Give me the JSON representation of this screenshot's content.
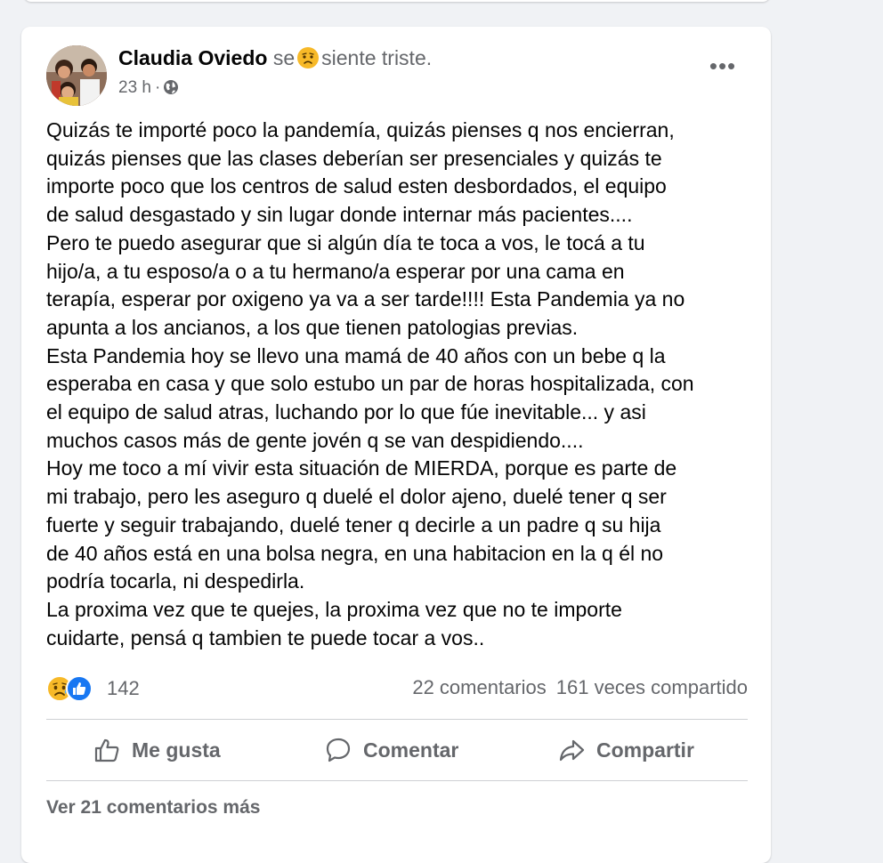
{
  "post": {
    "author": "Claudia Oviedo",
    "feeling_connector": "se",
    "feeling_text": "siente triste.",
    "feeling_icon": "sad-emoji-icon",
    "timestamp": "23 h",
    "privacy_icon": "globe-icon",
    "more_icon": "•••",
    "body_lines": [
      "Quizás te importé poco la pandemía, quizás pienses q nos encierran,",
      "quizás pienses que las clases deberían ser presenciales y quizás te",
      "importe poco que los centros de salud esten desbordados, el equipo",
      "de salud desgastado y sin lugar donde internar más pacientes....",
      "Pero te puedo asegurar que si algún día te toca a vos, le tocá a tu",
      "hijo/a, a tu esposo/a o a tu hermano/a esperar por una cama en",
      "terapía, esperar por oxigeno ya va a ser tarde!!!! Esta Pandemia ya no",
      "apunta a los ancianos, a los que tienen patologias previas.",
      "Esta Pandemia hoy se llevo una mamá de 40 años con un bebe q la",
      "esperaba en casa y que solo estubo un par de horas hospitalizada, con",
      "el equipo de salud atras, luchando por lo que fúe inevitable... y asi",
      "muchos casos más de gente jovén q se van despidiendo....",
      "Hoy me toco a mí vivir esta situación de MIERDA, porque es parte de",
      "mi trabajo, pero les aseguro q duelé el dolor ajeno, duelé tener q ser",
      "fuerte y seguir trabajando, duelé tener q decirle a un padre q su hija",
      "de 40 años está en una bolsa negra, en una habitacion en la q él  no",
      "podría tocarla, ni despedirla.",
      "La proxima vez que te quejes, la proxima vez que no te importe",
      "cuidarte, pensá q tambien te puede tocar a vos.."
    ]
  },
  "reactions": {
    "icons": [
      "sad-reaction-icon",
      "like-reaction-icon"
    ],
    "count": "142",
    "comments": "22 comentarios",
    "shares": "161 veces compartido"
  },
  "actions": {
    "like": "Me gusta",
    "comment": "Comentar",
    "share": "Compartir"
  },
  "view_more_comments": "Ver 21 comentarios más",
  "colors": {
    "page_bg": "#f0f2f5",
    "card_bg": "#ffffff",
    "primary_text": "#050505",
    "secondary_text": "#65676b",
    "divider": "#ced0d4",
    "like_blue": "#1877f2",
    "emoji_yellow": "#f7b928"
  }
}
